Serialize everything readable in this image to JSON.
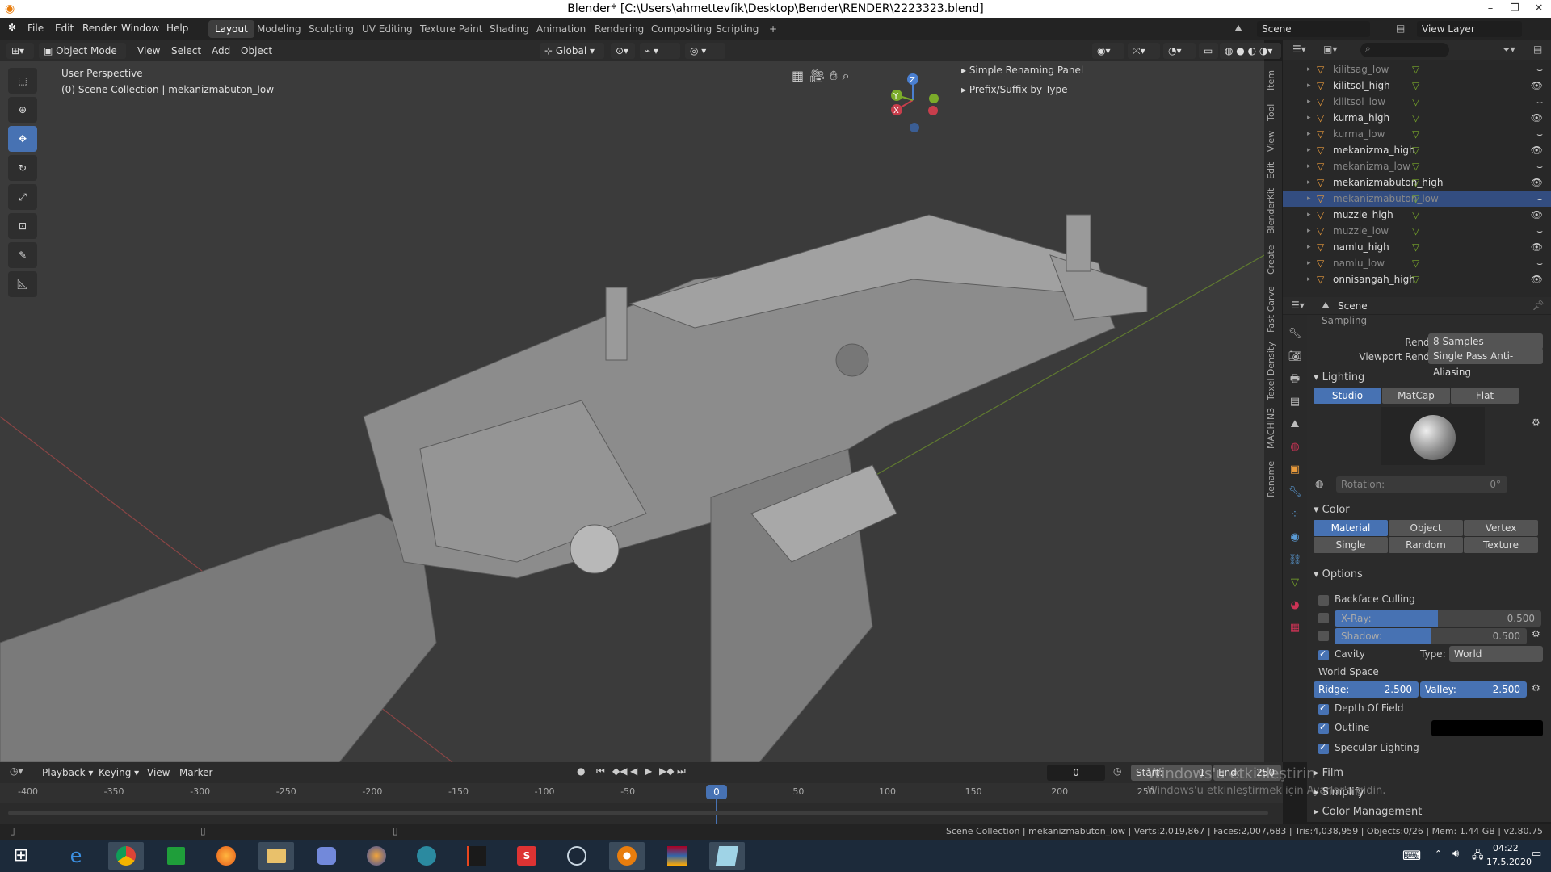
{
  "window": {
    "title": "Blender* [C:\\Users\\ahmettevfik\\Desktop\\Bender\\RENDER\\2223323.blend]"
  },
  "menu": [
    "File",
    "Edit",
    "Render",
    "Window",
    "Help"
  ],
  "workspaces": [
    "Layout",
    "Modeling",
    "Sculpting",
    "UV Editing",
    "Texture Paint",
    "Shading",
    "Animation",
    "Rendering",
    "Compositing",
    "Scripting"
  ],
  "scene": {
    "label": "Scene",
    "view_layer": "View Layer"
  },
  "viewport_header": {
    "mode": "Object Mode",
    "view": "View",
    "select": "Select",
    "add": "Add",
    "object": "Object",
    "orientation": "Global"
  },
  "viewport": {
    "perspective": "User Perspective",
    "collection": "(0) Scene Collection | mekanizmabuton_low"
  },
  "npanel": {
    "item1": "Simple Renaming Panel",
    "item2": "Prefix/Suffix by Type"
  },
  "gizmo": {
    "x": "X",
    "y": "Y",
    "z": "Z"
  },
  "vtabs": [
    "Item",
    "Tool",
    "View",
    "Edit",
    "BlenderKit",
    "Create",
    "Fast Carve",
    "Texel Density",
    "MACHIN3",
    "Rename"
  ],
  "outliner": [
    {
      "name": "kilitsag_low",
      "dim": true
    },
    {
      "name": "kilitsol_high",
      "dim": false
    },
    {
      "name": "kilitsol_low",
      "dim": true
    },
    {
      "name": "kurma_high",
      "dim": false
    },
    {
      "name": "kurma_low",
      "dim": true
    },
    {
      "name": "mekanizma_high",
      "dim": false
    },
    {
      "name": "mekanizma_low",
      "dim": true
    },
    {
      "name": "mekanizmabuton_high",
      "dim": false
    },
    {
      "name": "mekanizmabuton_low",
      "dim": true,
      "selected": true
    },
    {
      "name": "muzzle_high",
      "dim": false
    },
    {
      "name": "muzzle_low",
      "dim": true
    },
    {
      "name": "namlu_high",
      "dim": false
    },
    {
      "name": "namlu_low",
      "dim": true
    },
    {
      "name": "onnisangah_high",
      "dim": false
    }
  ],
  "props": {
    "header": "Scene",
    "sampling": "Sampling",
    "render_label": "Render",
    "render_value": "8 Samples",
    "viewport_render_label": "Viewport Render",
    "viewport_render_value": "Single Pass Anti-Aliasing",
    "lighting": "Lighting",
    "lighting_modes": [
      "Studio",
      "MatCap",
      "Flat"
    ],
    "rotation_label": "Rotation:",
    "rotation_value": "0°",
    "color": "Color",
    "color_modes": [
      "Material",
      "Object",
      "Vertex",
      "Single",
      "Random",
      "Texture"
    ],
    "options": "Options",
    "backface": "Backface Culling",
    "xray_label": "X-Ray:",
    "xray_value": "0.500",
    "xray_level": 0.5,
    "shadow_label": "Shadow:",
    "shadow_value": "0.500",
    "shadow_level": 0.5,
    "cavity": "Cavity",
    "type_label": "Type:",
    "type_value": "World",
    "world_space": "World Space",
    "ridge_label": "Ridge:",
    "ridge_value": "2.500",
    "valley_label": "Valley:",
    "valley_value": "2.500",
    "dof": "Depth Of Field",
    "outline": "Outline",
    "specular": "Specular Lighting",
    "film": "Film",
    "simplify": "Simplify",
    "color_mgmt": "Color Management"
  },
  "timeline": {
    "menus": [
      "Playback",
      "Keying",
      "View",
      "Marker"
    ],
    "current": "0",
    "start_label": "Start:",
    "start": "1",
    "end_label": "End:",
    "end": "250",
    "ticks": [
      "-400",
      "-350",
      "-300",
      "-250",
      "-200",
      "-150",
      "-100",
      "-50",
      "0",
      "50",
      "100",
      "150",
      "200",
      "250"
    ],
    "playhead": "0"
  },
  "watermark": {
    "line1": "Windows'u etkinleştirin",
    "line2": "Windows'u etkinleştirmek için Ayarlar'a gidin."
  },
  "statusbar": "Scene Collection | mekanizmabuton_low | Verts:2,019,867 | Faces:2,007,683 | Tris:4,038,959 | Objects:0/26 | Mem: 1.44 GB | v2.80.75",
  "clock": {
    "time": "04:22",
    "date": "17.5.2020"
  },
  "colors": {
    "accent": "#4772b3",
    "viewport_bg": "#3b3b3b",
    "panel": "#2b2b2b"
  }
}
